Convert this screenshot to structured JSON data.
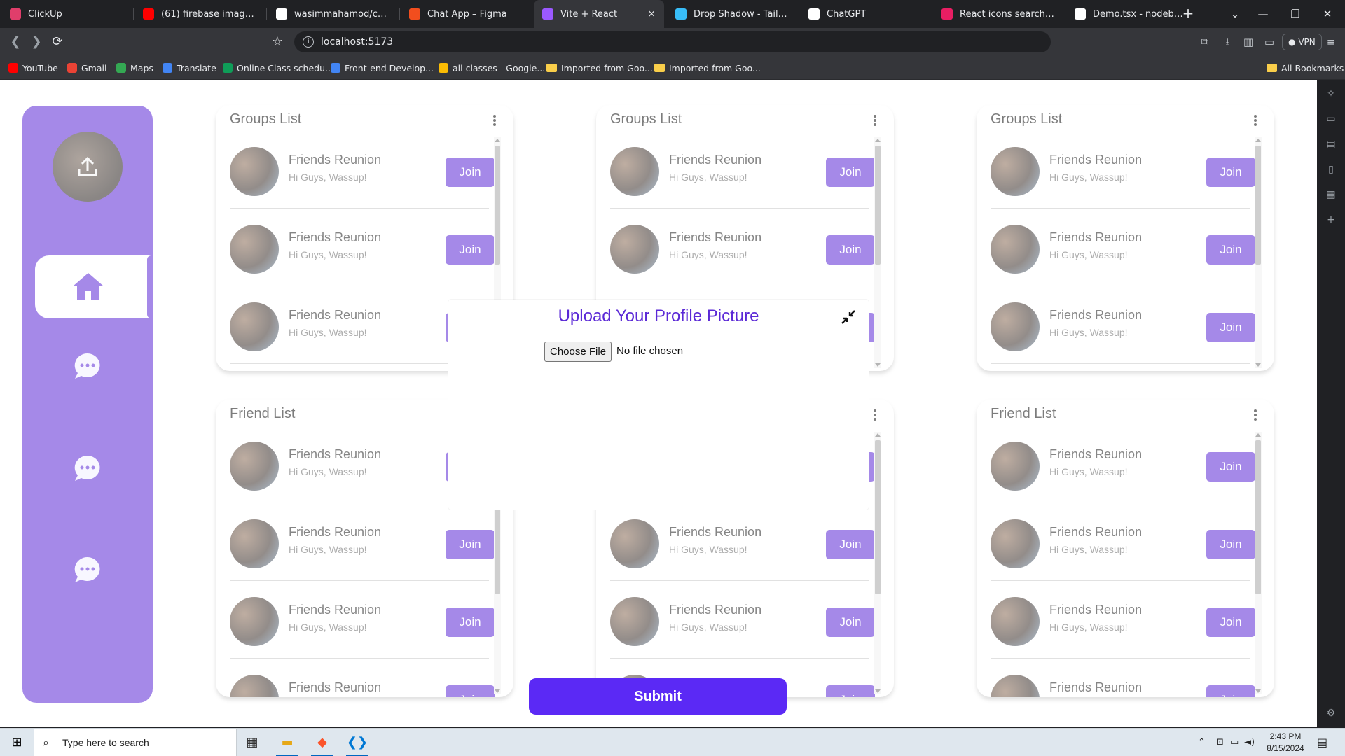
{
  "browser": {
    "tabs": [
      {
        "title": "ClickUp",
        "color": "#e03e6b"
      },
      {
        "title": "(61) firebase image uploa",
        "color": "#ff0000"
      },
      {
        "title": "wasimmahamod/chatapp",
        "color": "#ffffff"
      },
      {
        "title": "Chat App – Figma",
        "color": "#f24e1e"
      },
      {
        "title": "Vite + React",
        "color": "#9b59ff"
      },
      {
        "title": "Drop Shadow - Tailwind C",
        "color": "#38bdf8"
      },
      {
        "title": "ChatGPT",
        "color": "#ffffff"
      },
      {
        "title": "React icons search results",
        "color": "#e91e63"
      },
      {
        "title": "Demo.tsx - nodebox - Coc",
        "color": "#ffffff"
      }
    ],
    "active_tab_close": "×",
    "new_tab": "+",
    "url": "localhost:5173",
    "vpn_label": "VPN",
    "bookmarks": [
      {
        "label": "YouTube",
        "color": "#ff0000"
      },
      {
        "label": "Gmail",
        "color": "#ea4335"
      },
      {
        "label": "Maps",
        "color": "#34a853"
      },
      {
        "label": "Translate",
        "color": "#4285f4"
      },
      {
        "label": "Online Class schedu...",
        "color": "#0f9d58"
      },
      {
        "label": "Front-end Develop...",
        "color": "#4285f4"
      },
      {
        "label": "all classes - Google...",
        "color": "#fbbc04"
      },
      {
        "label": "Imported from Goo...",
        "color": "#f9ce4a"
      },
      {
        "label": "Imported from Goo...",
        "color": "#f9ce4a"
      }
    ],
    "all_bookmarks": "All Bookmarks"
  },
  "cards": [
    {
      "title": "Groups List",
      "scroll": true
    },
    {
      "title": "Groups List",
      "scroll": true
    },
    {
      "title": "Groups List",
      "scroll": true
    },
    {
      "title": "Friend List",
      "scroll": true
    },
    {
      "title": "Friend List",
      "scroll": true
    },
    {
      "title": "Friend List",
      "scroll": true
    }
  ],
  "row": {
    "name": "Friends Reunion",
    "message": "Hi Guys, Wassup!",
    "button": "Join"
  },
  "modal": {
    "title": "Upload Your Profile Picture",
    "choose_file": "Choose File",
    "file_status": "No file chosen"
  },
  "submit_label": "Submit",
  "taskbar": {
    "search_placeholder": "Type here to search",
    "time": "2:43 PM",
    "date": "8/15/2024"
  },
  "colors": {
    "primary": "#5b29d6",
    "submit": "#5b29f5",
    "modal_title": "#5b29d6"
  }
}
